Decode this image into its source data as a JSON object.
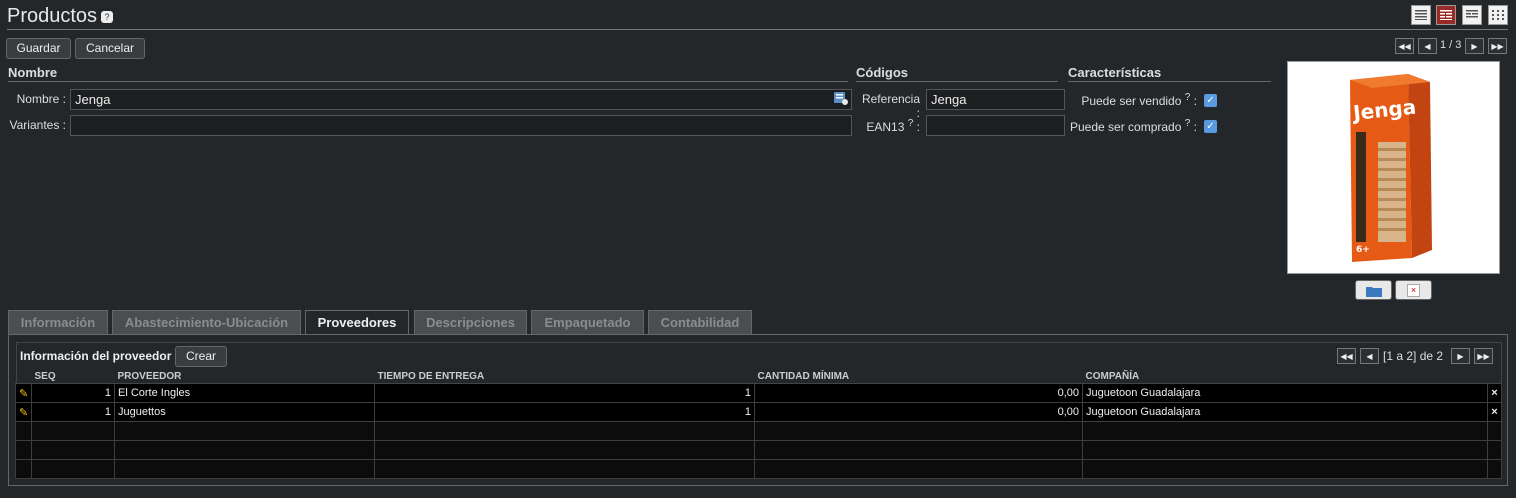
{
  "header": {
    "title": "Productos",
    "help": "?",
    "view_switcher": [
      "list-view-icon",
      "form-view-icon",
      "page-view-icon",
      "grid-view-icon"
    ]
  },
  "toolbar": {
    "save_label": "Guardar",
    "cancel_label": "Cancelar",
    "pager": "1 / 3"
  },
  "sections": {
    "nombre": {
      "title": "Nombre",
      "name_label": "Nombre :",
      "name_value": "Jenga",
      "variants_label": "Variantes :",
      "variants_value": ""
    },
    "codigos": {
      "title": "Códigos",
      "ref_label": "Referencia :",
      "ref_value": "Jenga",
      "ean_label": "EAN13",
      "ean_help": "?",
      "ean_colon": ":",
      "ean_value": ""
    },
    "caracteristicas": {
      "title": "Características",
      "sold_label": "Puede ser vendido",
      "sold_help": "?",
      "sold_colon": ":",
      "sold_checked": true,
      "purchased_label": "Puede ser comprado",
      "purchased_help": "?",
      "purchased_colon": ":",
      "purchased_checked": true
    }
  },
  "image": {
    "brand": "Jenga",
    "badge": "6+"
  },
  "tabs": [
    {
      "label": "Información",
      "active": false
    },
    {
      "label": "Abastecimiento-Ubicación",
      "active": false
    },
    {
      "label": "Proveedores",
      "active": true
    },
    {
      "label": "Descripciones",
      "active": false
    },
    {
      "label": "Empaquetado",
      "active": false
    },
    {
      "label": "Contabilidad",
      "active": false
    }
  ],
  "suppliers": {
    "title": "Información del proveedor",
    "create_label": "Crear",
    "pager": "[1 a 2] de 2",
    "columns": [
      "SEQ",
      "PROVEEDOR",
      "TIEMPO DE ENTREGA",
      "CANTIDAD MÍNIMA",
      "COMPAÑÍA"
    ],
    "rows": [
      {
        "seq": "1",
        "supplier": "El Corte Ingles",
        "lead_time": "1",
        "min_qty": "0,00",
        "company": "Juguetoon Guadalajara"
      },
      {
        "seq": "1",
        "supplier": "Juguettos",
        "lead_time": "1",
        "min_qty": "0,00",
        "company": "Juguetoon Guadalajara"
      }
    ]
  }
}
